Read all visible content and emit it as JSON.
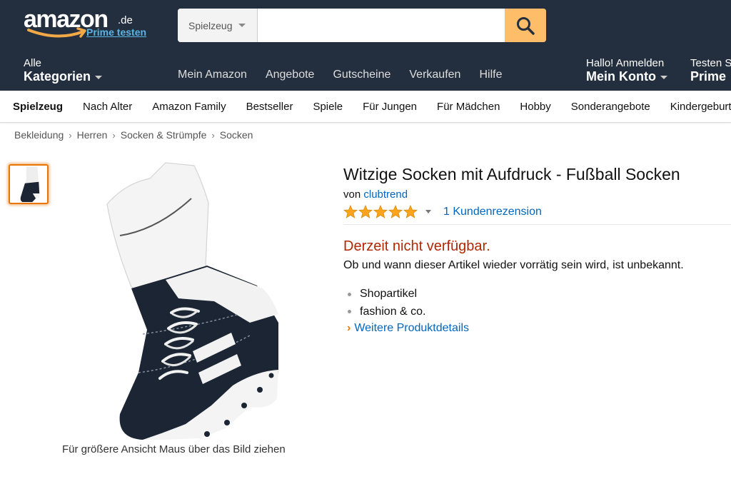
{
  "header": {
    "logo_text": "amazon",
    "logo_tld": ".de",
    "prime_link": "Prime testen",
    "search": {
      "category": "Spielzeug",
      "value": "",
      "placeholder": ""
    },
    "categories_small": "Alle",
    "categories_big": "Kategorien",
    "links": [
      "Mein Amazon",
      "Angebote",
      "Gutscheine",
      "Verkaufen",
      "Hilfe"
    ],
    "account_small": "Hallo! Anmelden",
    "account_big": "Mein Konto",
    "prime_small": "Testen Sie",
    "prime_big": "Prime"
  },
  "subnav": [
    "Spielzeug",
    "Nach Alter",
    "Amazon Family",
    "Bestseller",
    "Spiele",
    "Für Jungen",
    "Für Mädchen",
    "Hobby",
    "Sonderangebote",
    "Kindergeburtstag"
  ],
  "breadcrumb": [
    "Bekleidung",
    "Herren",
    "Socken & Strümpfe",
    "Socken"
  ],
  "image": {
    "caption": "Für größere Ansicht Maus über das Bild ziehen"
  },
  "product": {
    "title": "Witzige Socken mit Aufdruck - Fußball Socken",
    "by_prefix": "von",
    "brand": "clubtrend",
    "rating": 5,
    "reviews_label": "1 Kundenrezension",
    "availability": "Derzeit nicht verfügbar.",
    "availability_note": "Ob und wann dieser Artikel wieder vorrätig sein wird, ist unbekannt.",
    "bullets": [
      "Shopartikel",
      "fashion & co."
    ],
    "more_details": "Weitere Produktdetails"
  },
  "colors": {
    "header_bg": "#232f3e",
    "search_button": "#febd69",
    "link": "#0066c0",
    "unavailable": "#b12704",
    "star": "#ffa41c",
    "thumb_border": "#e77600"
  },
  "icons": {
    "search_button": "search-icon",
    "logo_smile": "amazon-smile-icon",
    "star": "star-icon"
  }
}
